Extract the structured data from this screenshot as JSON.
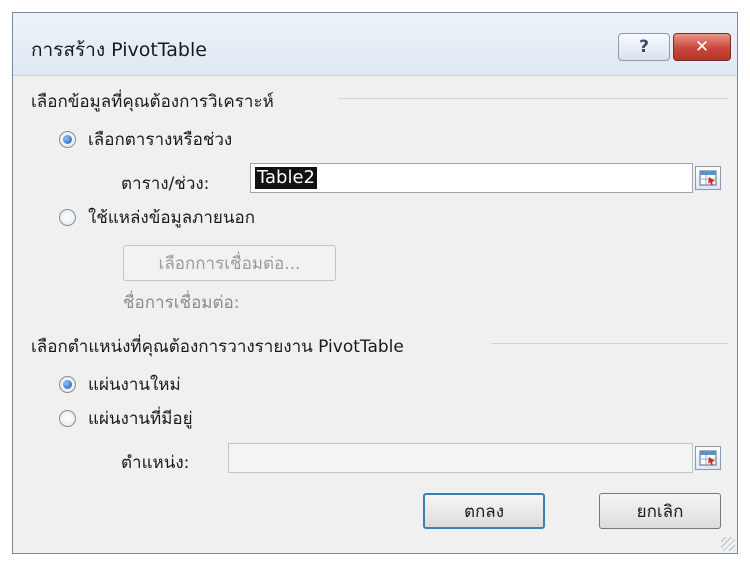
{
  "dialog": {
    "title": "การสร้าง PivotTable",
    "help_label": "?",
    "close_label": "✕"
  },
  "data_section": {
    "heading": "เลือกข้อมูลที่คุณต้องการวิเคราะห์",
    "option_table": "เลือกตารางหรือช่วง",
    "table_range_label": "ตาราง/ช่วง:",
    "table_range_value": "Table2",
    "option_external": "ใช้แหล่งข้อมูลภายนอก",
    "choose_connection_label": "เลือกการเชื่อมต่อ...",
    "connection_name_label": "ชื่อการเชื่อมต่อ:",
    "selected_option": "table"
  },
  "location_section": {
    "heading": "เลือกตำแหน่งที่คุณต้องการวางรายงาน PivotTable",
    "option_new_sheet": "แผ่นงานใหม่",
    "option_existing_sheet": "แผ่นงานที่มีอยู่",
    "location_label": "ตำแหน่ง:",
    "location_value": "",
    "selected_option": "new"
  },
  "buttons": {
    "ok_label": "ตกลง",
    "cancel_label": "ยกเลิก"
  },
  "colors": {
    "accent": "#3c7fb1",
    "close_button": "#c9473a"
  },
  "icons": [
    "help-icon",
    "close-icon",
    "range-selector-icon"
  ]
}
